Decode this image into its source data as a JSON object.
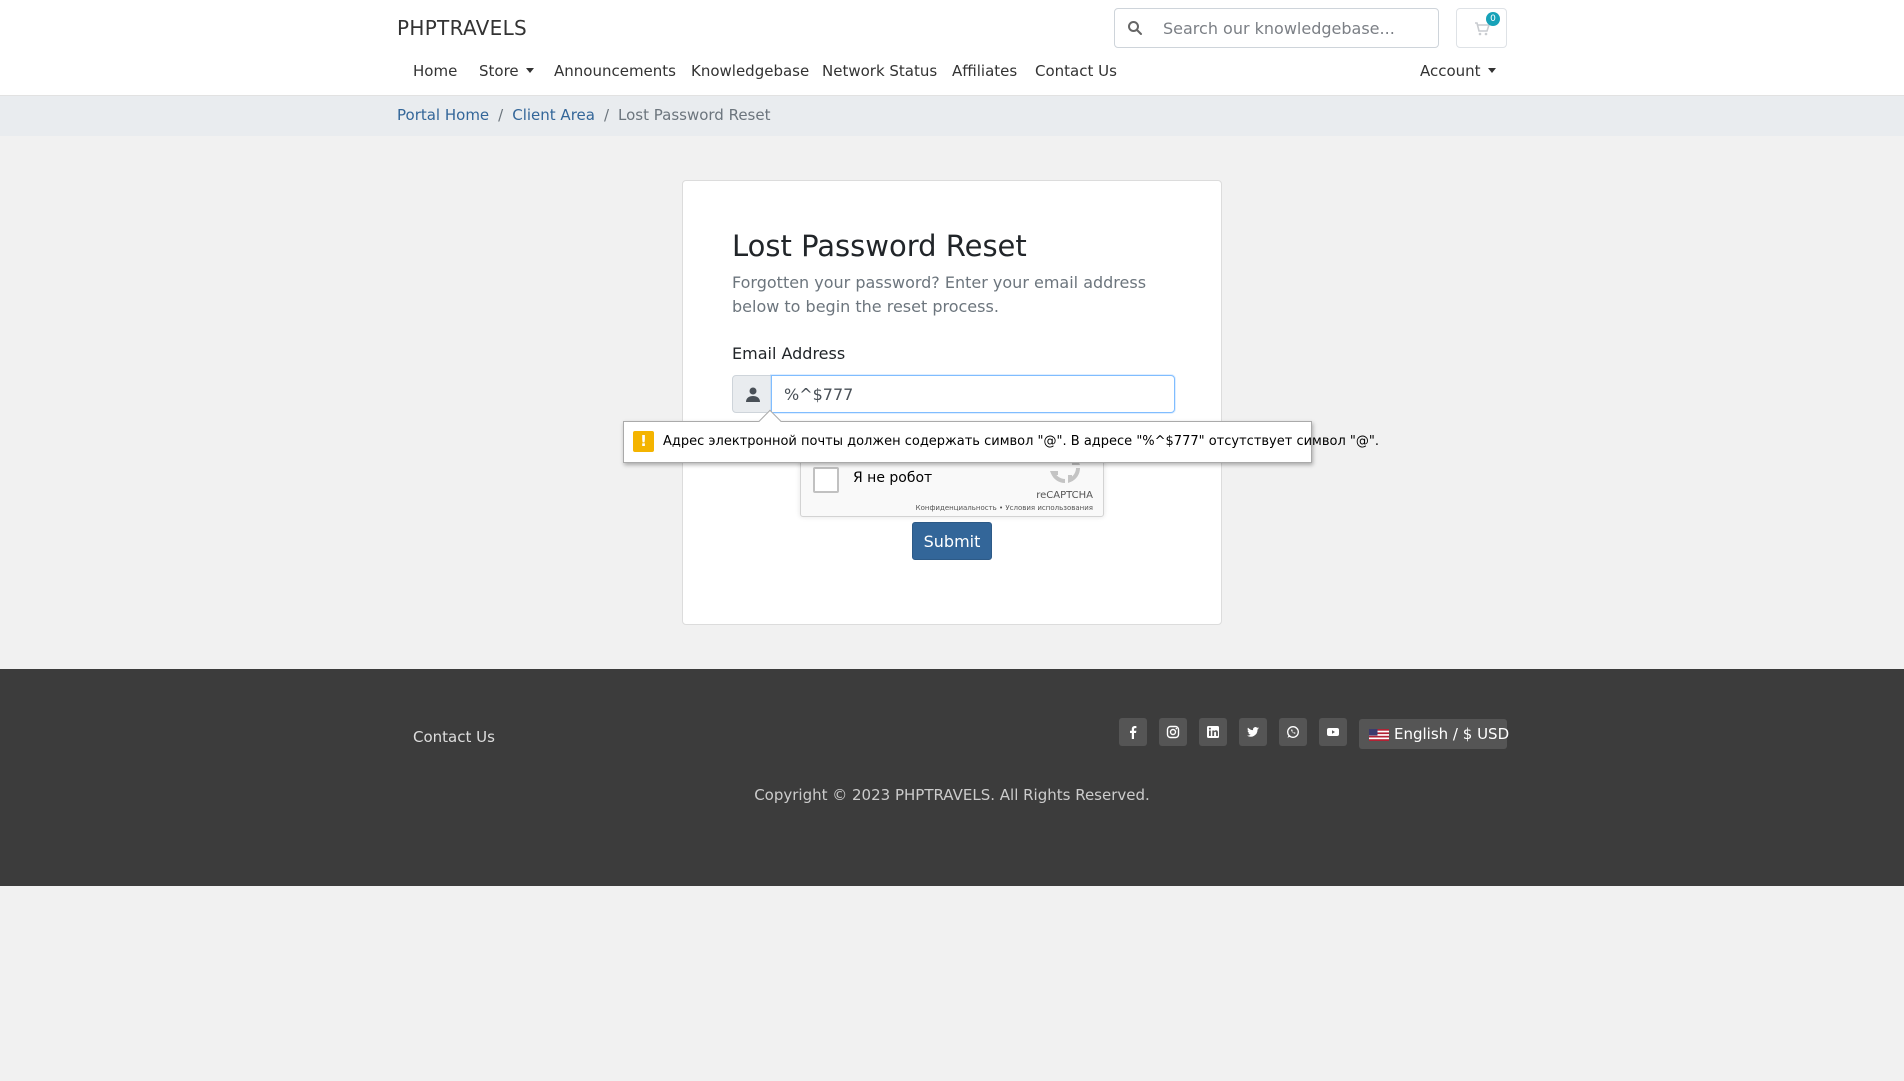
{
  "header": {
    "brand": "PHPTRAVELS",
    "search_placeholder": "Search our knowledgebase...",
    "cart_count": "0"
  },
  "nav": {
    "items": [
      "Home",
      "Store",
      "Announcements",
      "Knowledgebase",
      "Network Status",
      "Affiliates",
      "Contact Us"
    ],
    "account": "Account"
  },
  "breadcrumb": {
    "items": [
      "Portal Home",
      "Client Area"
    ],
    "current": "Lost Password Reset"
  },
  "form": {
    "title": "Lost Password Reset",
    "intro": "Forgotten your password? Enter your email address below to begin the reset process.",
    "email_label": "Email Address",
    "email_value": "%^$777",
    "submit_label": "Submit"
  },
  "recaptcha": {
    "label": "Я не робот",
    "brand": "reCAPTCHA",
    "terms": "Конфиденциальность • Условия использования"
  },
  "validation": {
    "message": "Адрес электронной почты должен содержать символ \"@\". В адресе \"%^$777\" отсутствует символ \"@\"."
  },
  "footer": {
    "contact_link": "Contact Us",
    "social_icons": [
      "facebook-icon",
      "instagram-icon",
      "linkedin-icon",
      "twitter-icon",
      "whatsapp-icon",
      "youtube-icon"
    ],
    "language": "English / $ USD",
    "copyright": "Copyright © 2023 PHPTRAVELS. All Rights Reserved."
  },
  "colors": {
    "primary": "#336699",
    "footer_bg": "#3c3c3c",
    "badge": "#17a2b8",
    "warning": "#f4b400"
  }
}
